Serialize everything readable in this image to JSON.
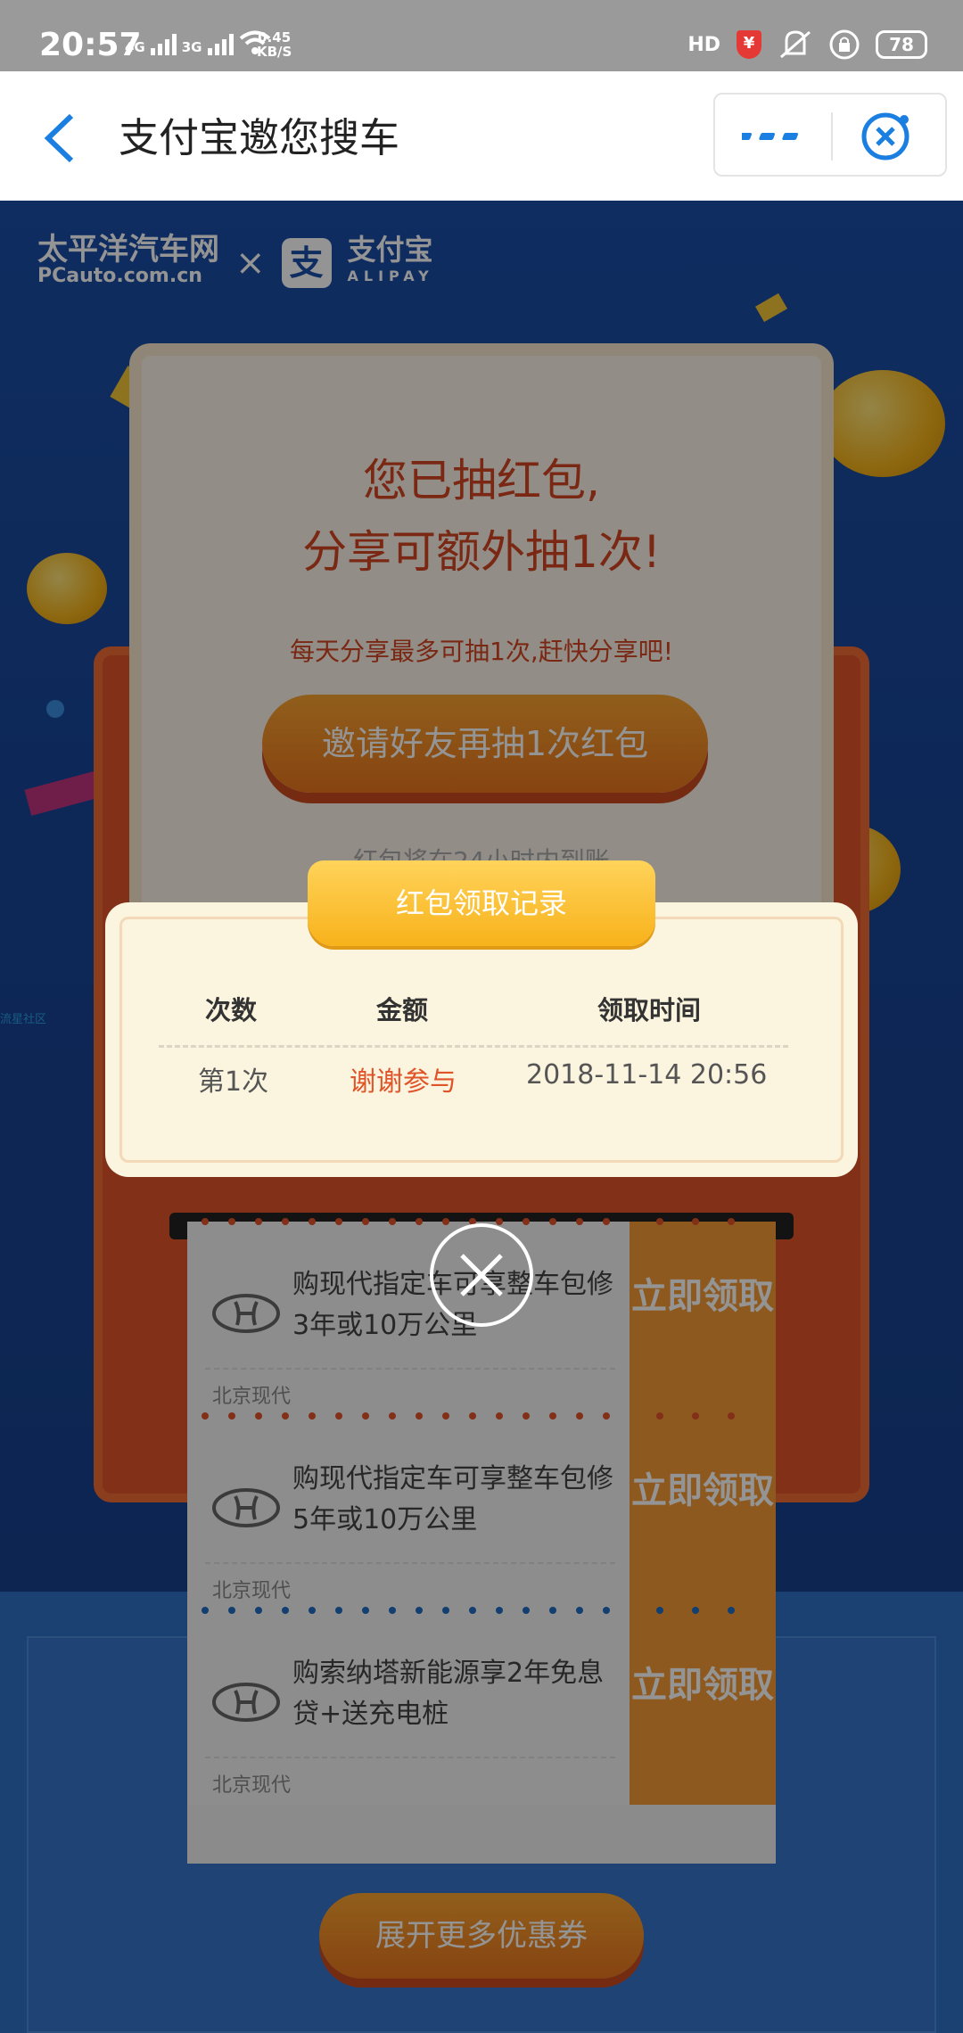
{
  "status": {
    "time": "20:57",
    "net1": "4G",
    "net2": "3G",
    "speed_value": "0.45",
    "speed_unit": "KB/S",
    "hd": "HD",
    "battery": "78"
  },
  "header": {
    "title": "支付宝邀您搜车"
  },
  "brands": {
    "pc_name": "太平洋汽车网",
    "pc_domain": "PCauto.com.cn",
    "cross": "×",
    "alipay_name": "支付宝",
    "alipay_en": "ALIPAY"
  },
  "card": {
    "line1": "您已抽红包,",
    "line2": "分享可额外抽1次!",
    "line3": "每天分享最多可抽1次,赶快分享吧!",
    "invite_button": "邀请好友再抽1次红包",
    "notice": "红包将在24小时内到账"
  },
  "modal": {
    "title": "红包领取记录",
    "columns": [
      "次数",
      "金额",
      "领取时间"
    ],
    "rows": [
      {
        "count": "第1次",
        "amount": "谢谢参与",
        "time": "2018-11-14 20:56"
      }
    ]
  },
  "coupons": [
    {
      "text": "购现代指定车可享整车包修3年或10万公里",
      "brand": "北京现代",
      "action": "立即领取"
    },
    {
      "text": "购现代指定车可享整车包修5年或10万公里",
      "brand": "北京现代",
      "action": "立即领取"
    },
    {
      "text": "购索纳塔新能源享2年免息贷+送充电桩",
      "brand": "北京现代",
      "action": "立即领取"
    }
  ],
  "expand_button": "展开更多优惠券",
  "side_tag": "流星社区",
  "colors": {
    "accent_blue": "#1a7fe0",
    "page_blue": "#1b4ea6",
    "card_red": "#d34622",
    "orange": "#f49a36",
    "gold": "#f8b21b"
  }
}
